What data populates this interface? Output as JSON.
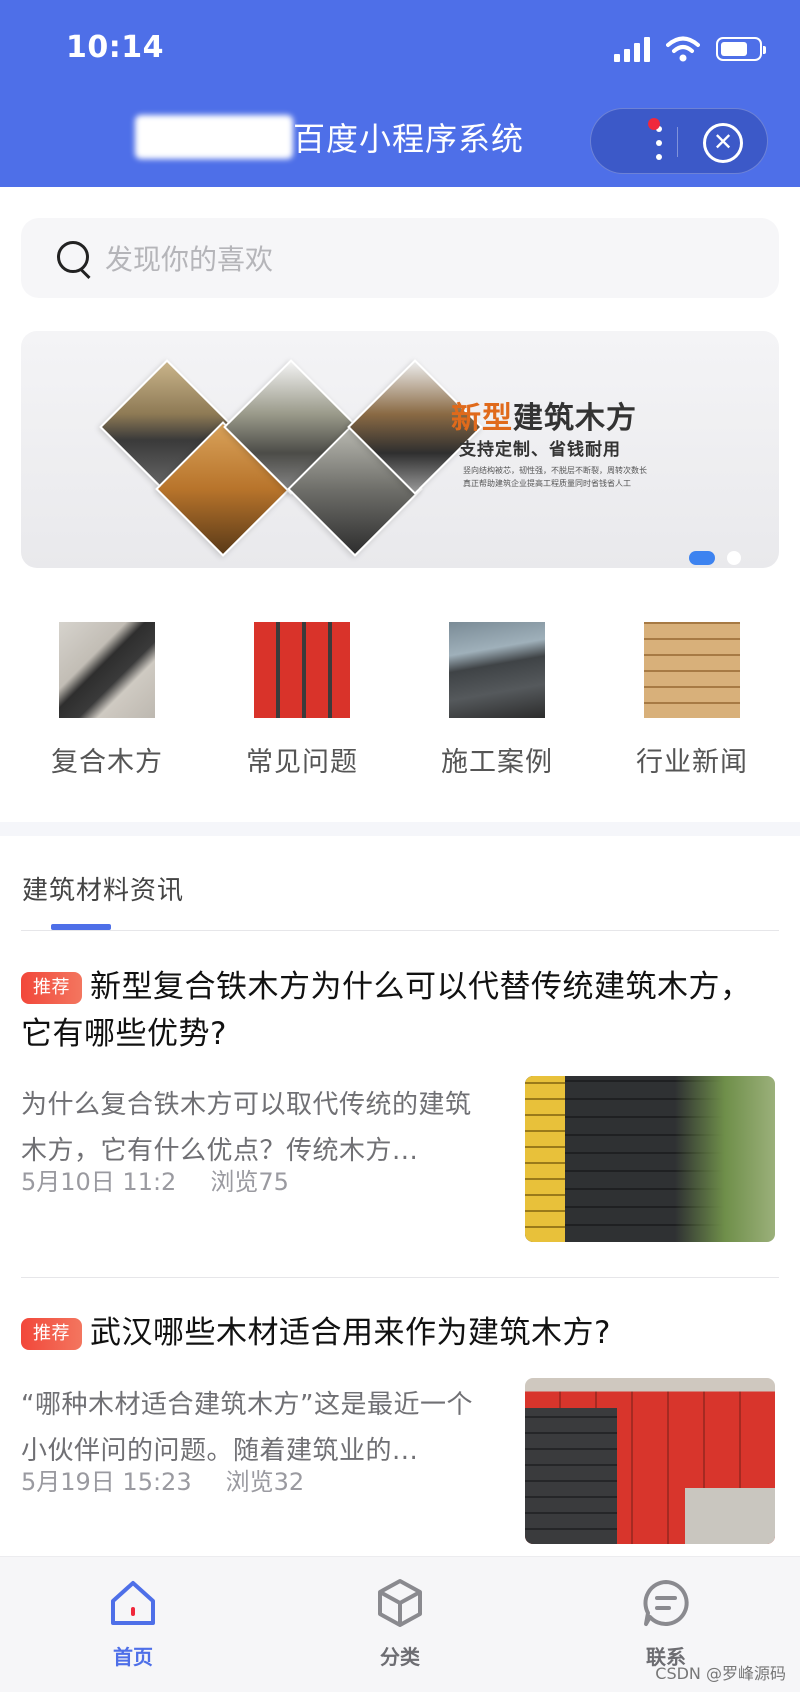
{
  "status_bar": {
    "time": "10:14"
  },
  "nav": {
    "title": "百度小程序系统",
    "more_icon": "more-dots-icon",
    "close_icon": "close-circle-icon",
    "close_glyph": "✕"
  },
  "search": {
    "placeholder": "发现你的喜欢"
  },
  "banner": {
    "headline_accent": "新型",
    "headline_rest": "建筑木方",
    "subheadline": "支持定制、省钱耐用",
    "small_line_1": "竖向结构被芯，韧性强，不脱层不断裂，周转次数长",
    "small_line_2": "真正帮助建筑企业提高工程质量同时省钱省人工",
    "active_slide": 1,
    "slide_count": 2
  },
  "categories": [
    {
      "label": "复合木方"
    },
    {
      "label": "常见问题"
    },
    {
      "label": "施工案例"
    },
    {
      "label": "行业新闻"
    }
  ],
  "news": {
    "tab_label": "建筑材料资讯",
    "articles": [
      {
        "tag": "推荐",
        "title": "新型复合铁木方为什么可以代替传统建筑木方，它有哪些优势?",
        "summary": "为什么复合铁木方可以取代传统的建筑木方，它有什么优点？传统木方...",
        "date": "5月10日 11:2",
        "views": "浏览75"
      },
      {
        "tag": "推荐",
        "title": "武汉哪些木材适合用来作为建筑木方?",
        "summary": "“哪种木材适合建筑木方”这是最近一个小伙伴问的问题。随着建筑业的...",
        "date": "5月19日 15:23",
        "views": "浏览32"
      }
    ]
  },
  "tabbar": {
    "items": [
      {
        "label": "首页",
        "icon": "home-icon",
        "active": true
      },
      {
        "label": "分类",
        "icon": "cube-icon",
        "active": false
      },
      {
        "label": "联系",
        "icon": "chat-icon",
        "active": false
      }
    ]
  },
  "watermark": "CSDN @罗峰源码",
  "colors": {
    "brand": "#4e6fe8",
    "tag": "#f2473a",
    "banner_accent": "#e06a1b",
    "dot_active": "#3d83f0"
  }
}
